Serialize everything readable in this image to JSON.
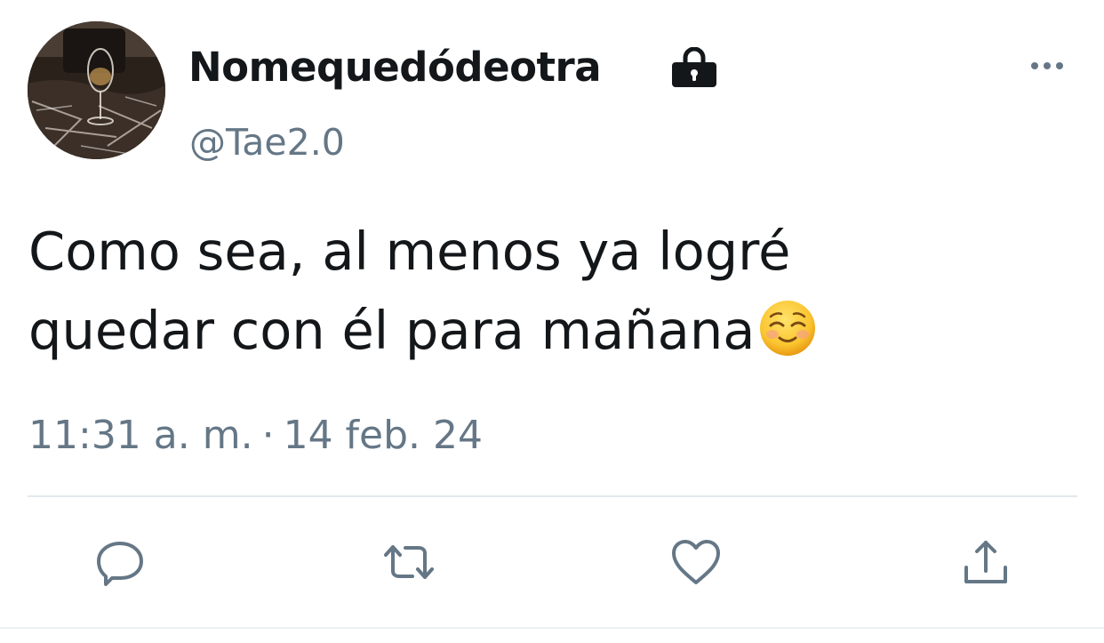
{
  "tweet": {
    "display_name": "Nomequedódeotra",
    "handle": "@Tae2.0",
    "text_line1": "Como sea, al menos ya logré",
    "text_line2": "quedar con él para mañana",
    "emoji": "smiling-face-with-closed-eyes-emoji",
    "time": "11:31 a. m.",
    "separator": "·",
    "date": "14 feb. 24",
    "protected_icon": "lock-icon",
    "more_icon": "more-dots-icon"
  },
  "actions": [
    {
      "name": "reply",
      "icon": "reply-icon"
    },
    {
      "name": "retweet",
      "icon": "retweet-icon"
    },
    {
      "name": "like",
      "icon": "heart-icon"
    },
    {
      "name": "share",
      "icon": "share-icon"
    }
  ],
  "colors": {
    "text": "#14171a",
    "secondary": "#657786",
    "divider": "#e1e8ed"
  }
}
